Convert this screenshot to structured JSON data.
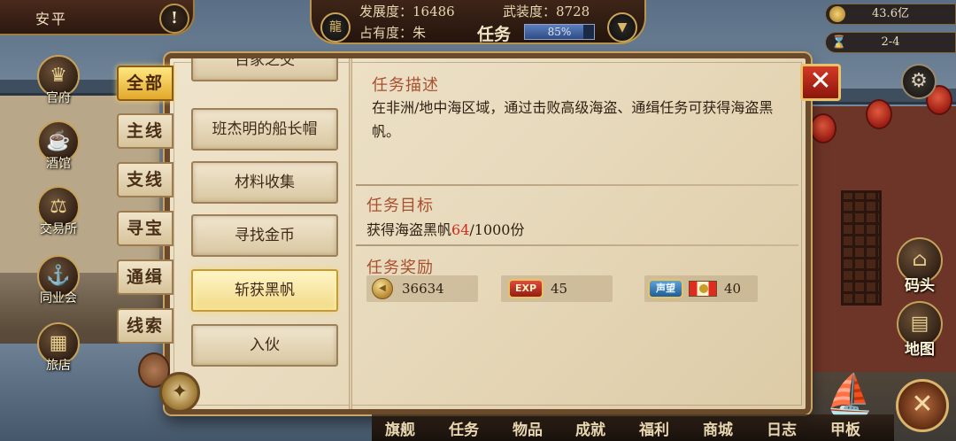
{
  "topbar": {
    "city_name": "安平",
    "alert_label": "!",
    "development": "发展度：16486",
    "armament": "武装度：8728",
    "occupancy": "占有度：朱",
    "task_title": "任务",
    "progress_text": "85%",
    "progress_value": 0.85
  },
  "resources": {
    "gold": "43.6亿",
    "time": "2-4"
  },
  "side_menu": [
    {
      "label": "官府",
      "icon": "crown-icon"
    },
    {
      "label": "酒馆",
      "icon": "beer-mug-icon"
    },
    {
      "label": "交易所",
      "icon": "scales-icon"
    },
    {
      "label": "同业会",
      "icon": "anchor-icon"
    },
    {
      "label": "旅店",
      "icon": "basket-icon"
    }
  ],
  "category_tabs": [
    {
      "label": "全部",
      "active": true
    },
    {
      "label": "主线",
      "active": false
    },
    {
      "label": "支线",
      "active": false
    },
    {
      "label": "寻宝",
      "active": false
    },
    {
      "label": "通缉",
      "active": false
    },
    {
      "label": "线索",
      "active": false
    }
  ],
  "task_list": [
    {
      "label": "百家之交",
      "active": false
    },
    {
      "label": "班杰明的船长帽",
      "active": false
    },
    {
      "label": "材料收集",
      "active": false
    },
    {
      "label": "寻找金币",
      "active": false
    },
    {
      "label": "斩获黑帆",
      "active": true
    },
    {
      "label": "入伙",
      "active": false
    }
  ],
  "detail": {
    "desc_title": "任务描述",
    "desc_text": "在非洲/地中海区域，通过击败高级海盗、通缉任务可获得海盗黑帆。",
    "goal_title": "任务目标",
    "goal_prefix": "获得海盗黑帆",
    "goal_current": "64",
    "goal_suffix": "/1000份",
    "reward_title": "任务奖励",
    "rewards": {
      "gold": "36634",
      "exp_badge": "EXP",
      "exp": "45",
      "rep_badge": "声望",
      "reputation": "40"
    }
  },
  "right_nav": [
    {
      "label": "码头",
      "icon": "dock-icon"
    },
    {
      "label": "地图",
      "icon": "map-scroll-icon"
    }
  ],
  "bottom_nav": [
    "旗舰",
    "任务",
    "物品",
    "成就",
    "福利",
    "商城",
    "日志",
    "甲板"
  ],
  "icons": {
    "close": "close-icon",
    "settings": "gear-icon",
    "compass": "compass-icon",
    "collapse": "cross-swords-icon"
  },
  "colors": {
    "accent_gold": "#e2a92c",
    "title_red": "#a8502f",
    "goal_red": "#d12b1e",
    "close_red": "#d43a26"
  }
}
